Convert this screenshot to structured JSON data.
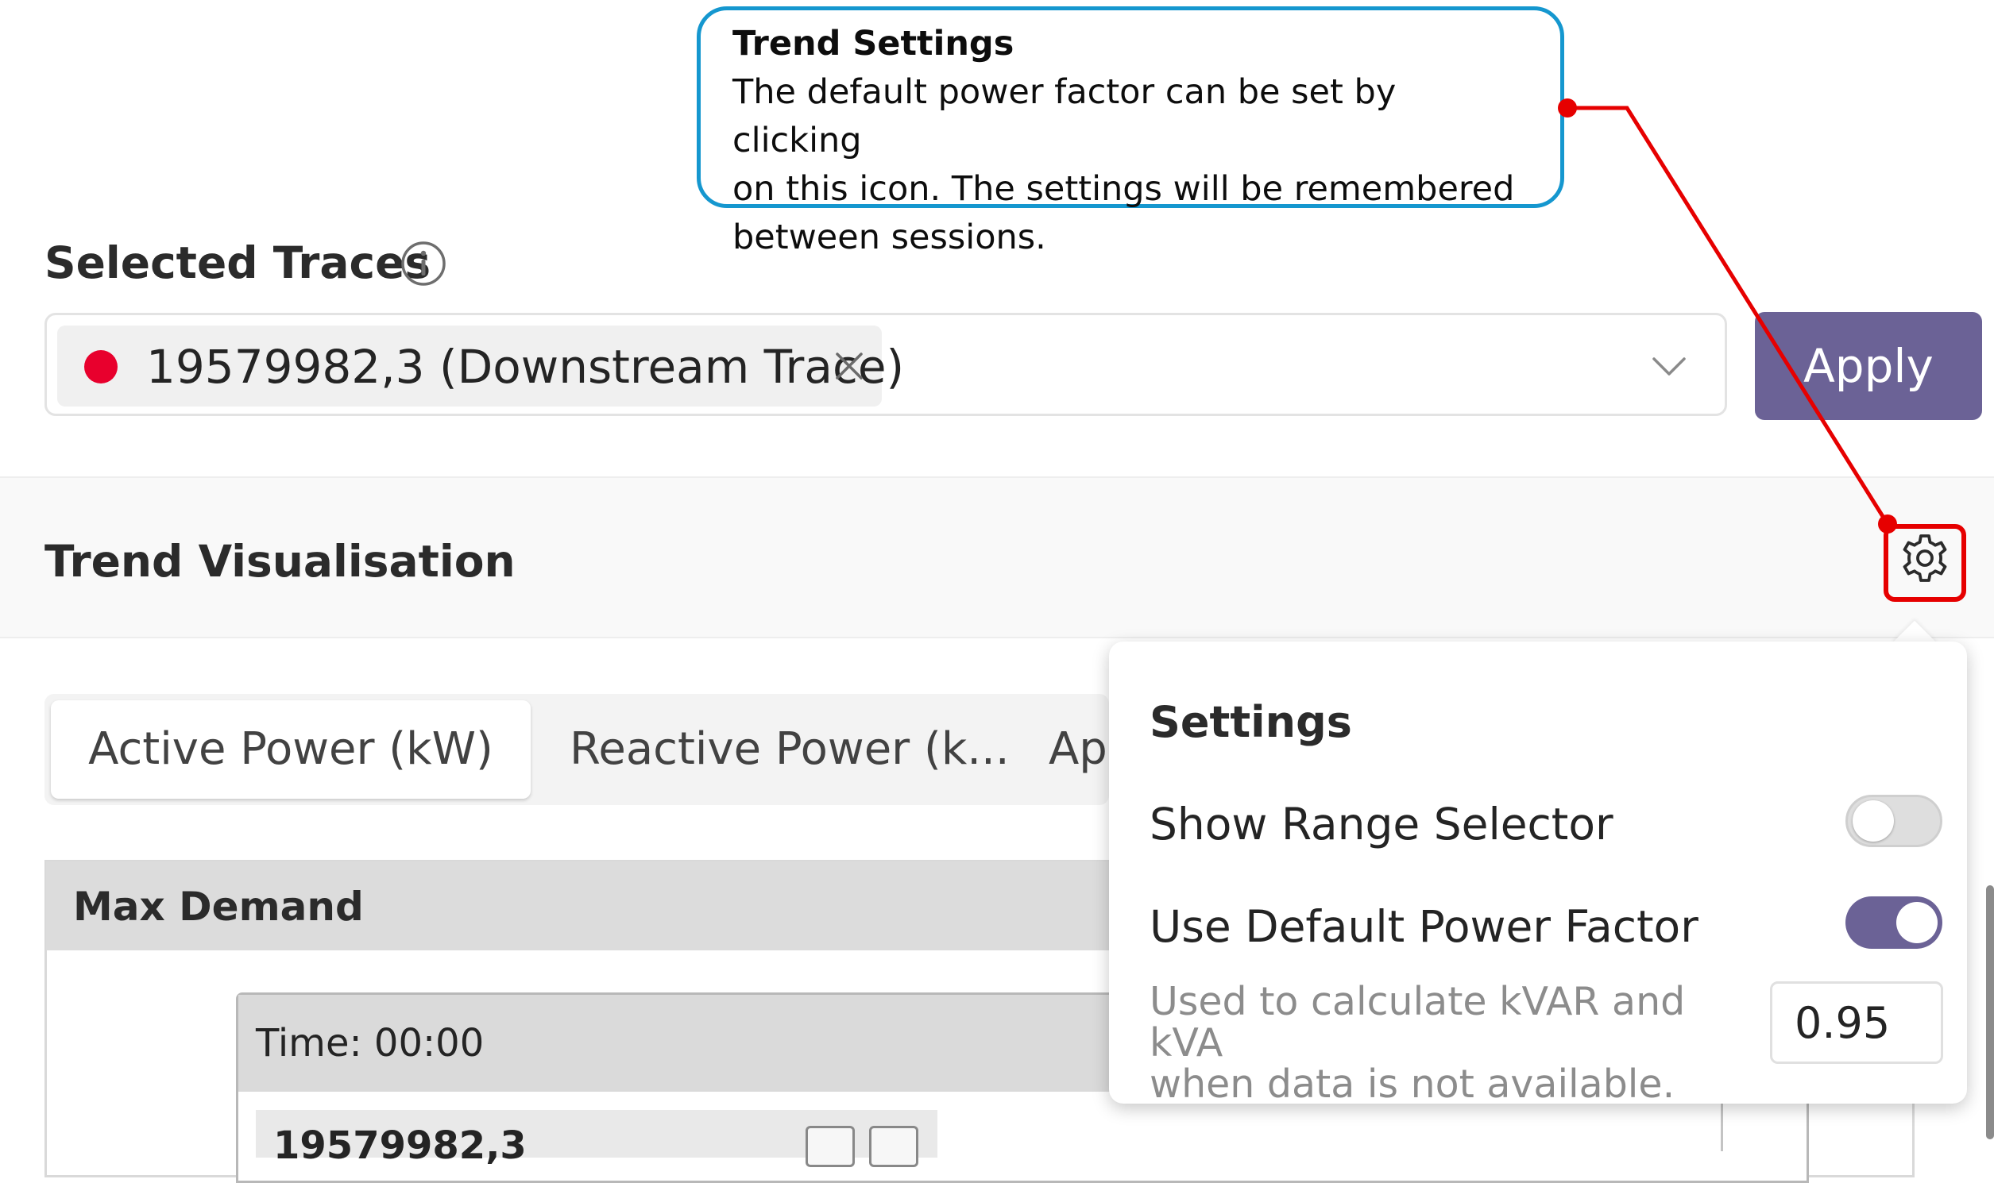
{
  "callout": {
    "title": "Trend Settings",
    "lines": [
      "The default power factor can be set by clicking",
      "on this icon. The settings will be remembered",
      "between sessions."
    ]
  },
  "selected_traces": {
    "title": "Selected Traces",
    "info_icon": "info-icon",
    "chip_label": "19579982,3 (Downstream Trace)",
    "chip_dot_color": "#e8002d",
    "apply_label": "Apply",
    "apply_color": "#6b6296"
  },
  "trend": {
    "title": "Trend Visualisation",
    "gear_icon": "gear-icon",
    "highlight_color": "#e60000"
  },
  "tabs": [
    {
      "label": "Active Power (kW)",
      "active": true
    },
    {
      "label": "Reactive Power (k..."
    },
    {
      "label": "Ap"
    }
  ],
  "max_demand": {
    "title": "Max Demand",
    "tooltip_time": "Time: 00:00",
    "tooltip_row_label": "19579982,3"
  },
  "settings": {
    "title": "Settings",
    "show_range_selector": {
      "label": "Show Range Selector",
      "on": false
    },
    "use_default_pf": {
      "label": "Use Default Power Factor",
      "on": true
    },
    "help_lines": [
      "Used to calculate kVAR and kVA",
      "when data is not available."
    ],
    "power_factor_value": "0.95"
  },
  "colors": {
    "callout_border": "#1597cf",
    "leader_line": "#e60000"
  }
}
